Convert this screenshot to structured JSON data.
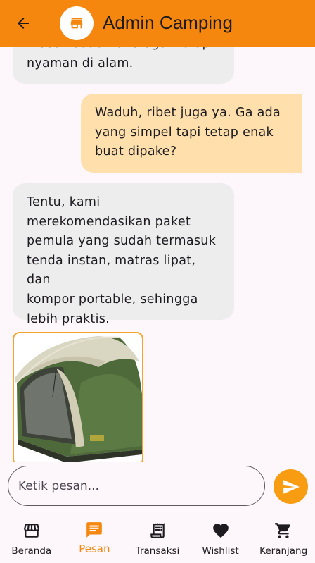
{
  "appbar": {
    "title": "Admin Camping",
    "back_icon": "arrow-back-icon",
    "avatar_icon": "store-icon"
  },
  "messages": [
    {
      "sender": "admin",
      "text": "masuk sederhana agar tetap\nnyaman di alam."
    },
    {
      "sender": "user",
      "text": "Waduh, ribet juga ya. Ga ada\nyang simpel tapi tetap enak\nbuat dipake?"
    },
    {
      "sender": "admin",
      "text": "Tentu, kami\nmerekomendasikan paket\npemula yang sudah termasuk\ntenda instan, matras lipat, dan\nkompor portable, sehingga\nlebih praktis."
    }
  ],
  "product_card": {
    "image": "dome-tent-image"
  },
  "composer": {
    "placeholder": "Ketik pesan...",
    "value": "",
    "send_icon": "send-icon"
  },
  "bottom_nav": {
    "items": [
      {
        "label": "Beranda",
        "icon": "store-icon",
        "active": false
      },
      {
        "label": "Pesan",
        "icon": "chat-icon",
        "active": true
      },
      {
        "label": "Transaksi",
        "icon": "receipt-icon",
        "active": false
      },
      {
        "label": "Wishlist",
        "icon": "heart-icon",
        "active": false
      },
      {
        "label": "Keranjang",
        "icon": "cart-icon",
        "active": false
      }
    ]
  },
  "colors": {
    "primary": "#f5870f",
    "admin_bubble": "#ededed",
    "user_bubble": "#ffe0ad",
    "background": "#fdf6fb"
  }
}
